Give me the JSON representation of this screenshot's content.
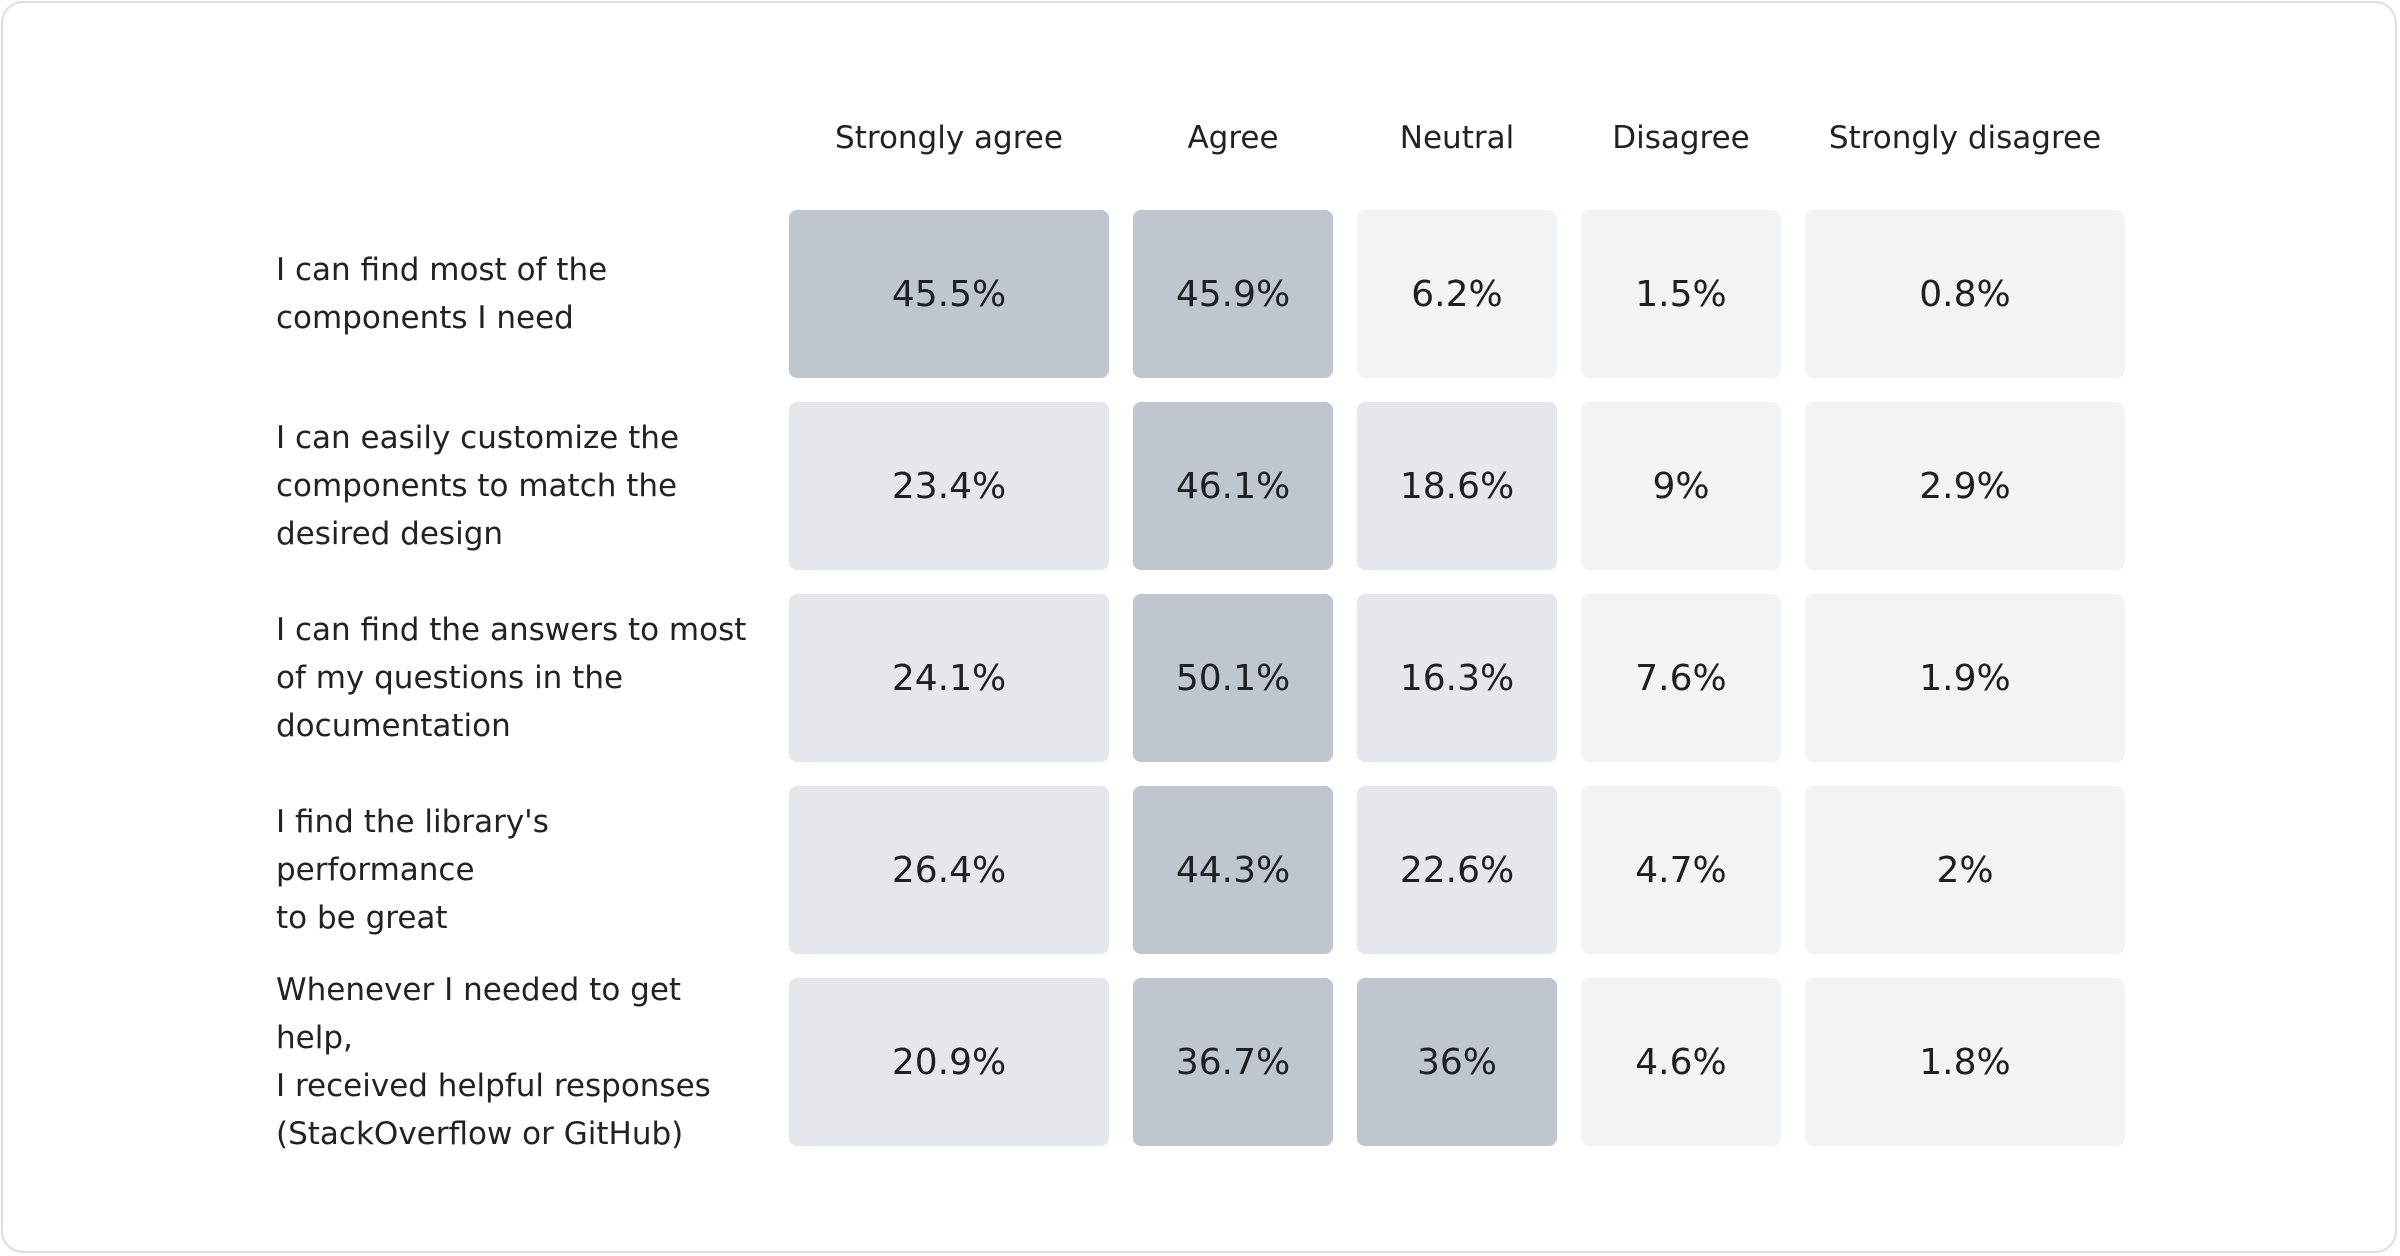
{
  "chart_data": {
    "type": "heatmap",
    "title": "",
    "columns": [
      "Strongly agree",
      "Agree",
      "Neutral",
      "Disagree",
      "Strongly disagree"
    ],
    "rows": [
      {
        "label": "I can find most of the\ncomponents I need",
        "values": [
          45.5,
          45.9,
          6.2,
          1.5,
          0.8
        ],
        "display": [
          "45.5%",
          "45.9%",
          "6.2%",
          "1.5%",
          "0.8%"
        ]
      },
      {
        "label": "I can easily customize the\ncomponents to match the\ndesired design",
        "values": [
          23.4,
          46.1,
          18.6,
          9,
          2.9
        ],
        "display": [
          "23.4%",
          "46.1%",
          "18.6%",
          "9%",
          "2.9%"
        ]
      },
      {
        "label": "I can find the answers to most\nof my questions in the\ndocumentation",
        "values": [
          24.1,
          50.1,
          16.3,
          7.6,
          1.9
        ],
        "display": [
          "24.1%",
          "50.1%",
          "16.3%",
          "7.6%",
          "1.9%"
        ]
      },
      {
        "label": "I find the library's performance\nto be great",
        "values": [
          26.4,
          44.3,
          22.6,
          4.7,
          2
        ],
        "display": [
          "26.4%",
          "44.3%",
          "22.6%",
          "4.7%",
          "2%"
        ]
      },
      {
        "label": "Whenever I needed to get help,\nI received helpful responses\n(StackOverflow or GitHub)",
        "values": [
          20.9,
          36.7,
          36,
          4.6,
          1.8
        ],
        "display": [
          "20.9%",
          "36.7%",
          "36%",
          "4.6%",
          "1.8%"
        ]
      }
    ],
    "unit": "%",
    "color_scale": {
      "high": {
        "min": 30,
        "color": "#bfc6ce"
      },
      "medium": {
        "min": 10,
        "color": "#e4e7eb"
      },
      "low": {
        "min": 0,
        "color": "#f1f4f7"
      }
    }
  }
}
